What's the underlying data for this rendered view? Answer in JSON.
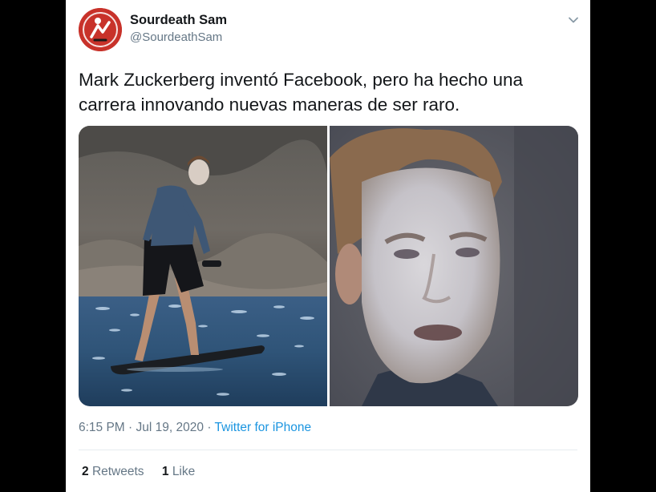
{
  "tweet": {
    "author": {
      "display_name": "Sourdeath Sam",
      "handle": "@SourdeathSam"
    },
    "text_line_1": "Mark Zuckerberg inventó Facebook, pero ha hecho una",
    "text_line_2": "carrera innovando nuevas maneras de ser raro.",
    "media": [
      {
        "kind": "photo",
        "subject": "man-standing-on-surfboard"
      },
      {
        "kind": "photo",
        "subject": "closeup-face-with-sunscreen"
      }
    ],
    "time": "6:15 PM",
    "date": "Jul 19, 2020",
    "separator": "·",
    "source": "Twitter for iPhone",
    "stats": {
      "retweets_count": "2",
      "retweets_label": "Retweets",
      "likes_count": "1",
      "likes_label": "Like"
    }
  },
  "icons": {
    "menu": "chevron-down-icon",
    "avatar": "avatar"
  },
  "colors": {
    "background": "#000000",
    "card": "#ffffff",
    "text": "#14171a",
    "secondary_text": "#657786",
    "link": "#1b95e0",
    "avatar_red": "#c8322a"
  }
}
